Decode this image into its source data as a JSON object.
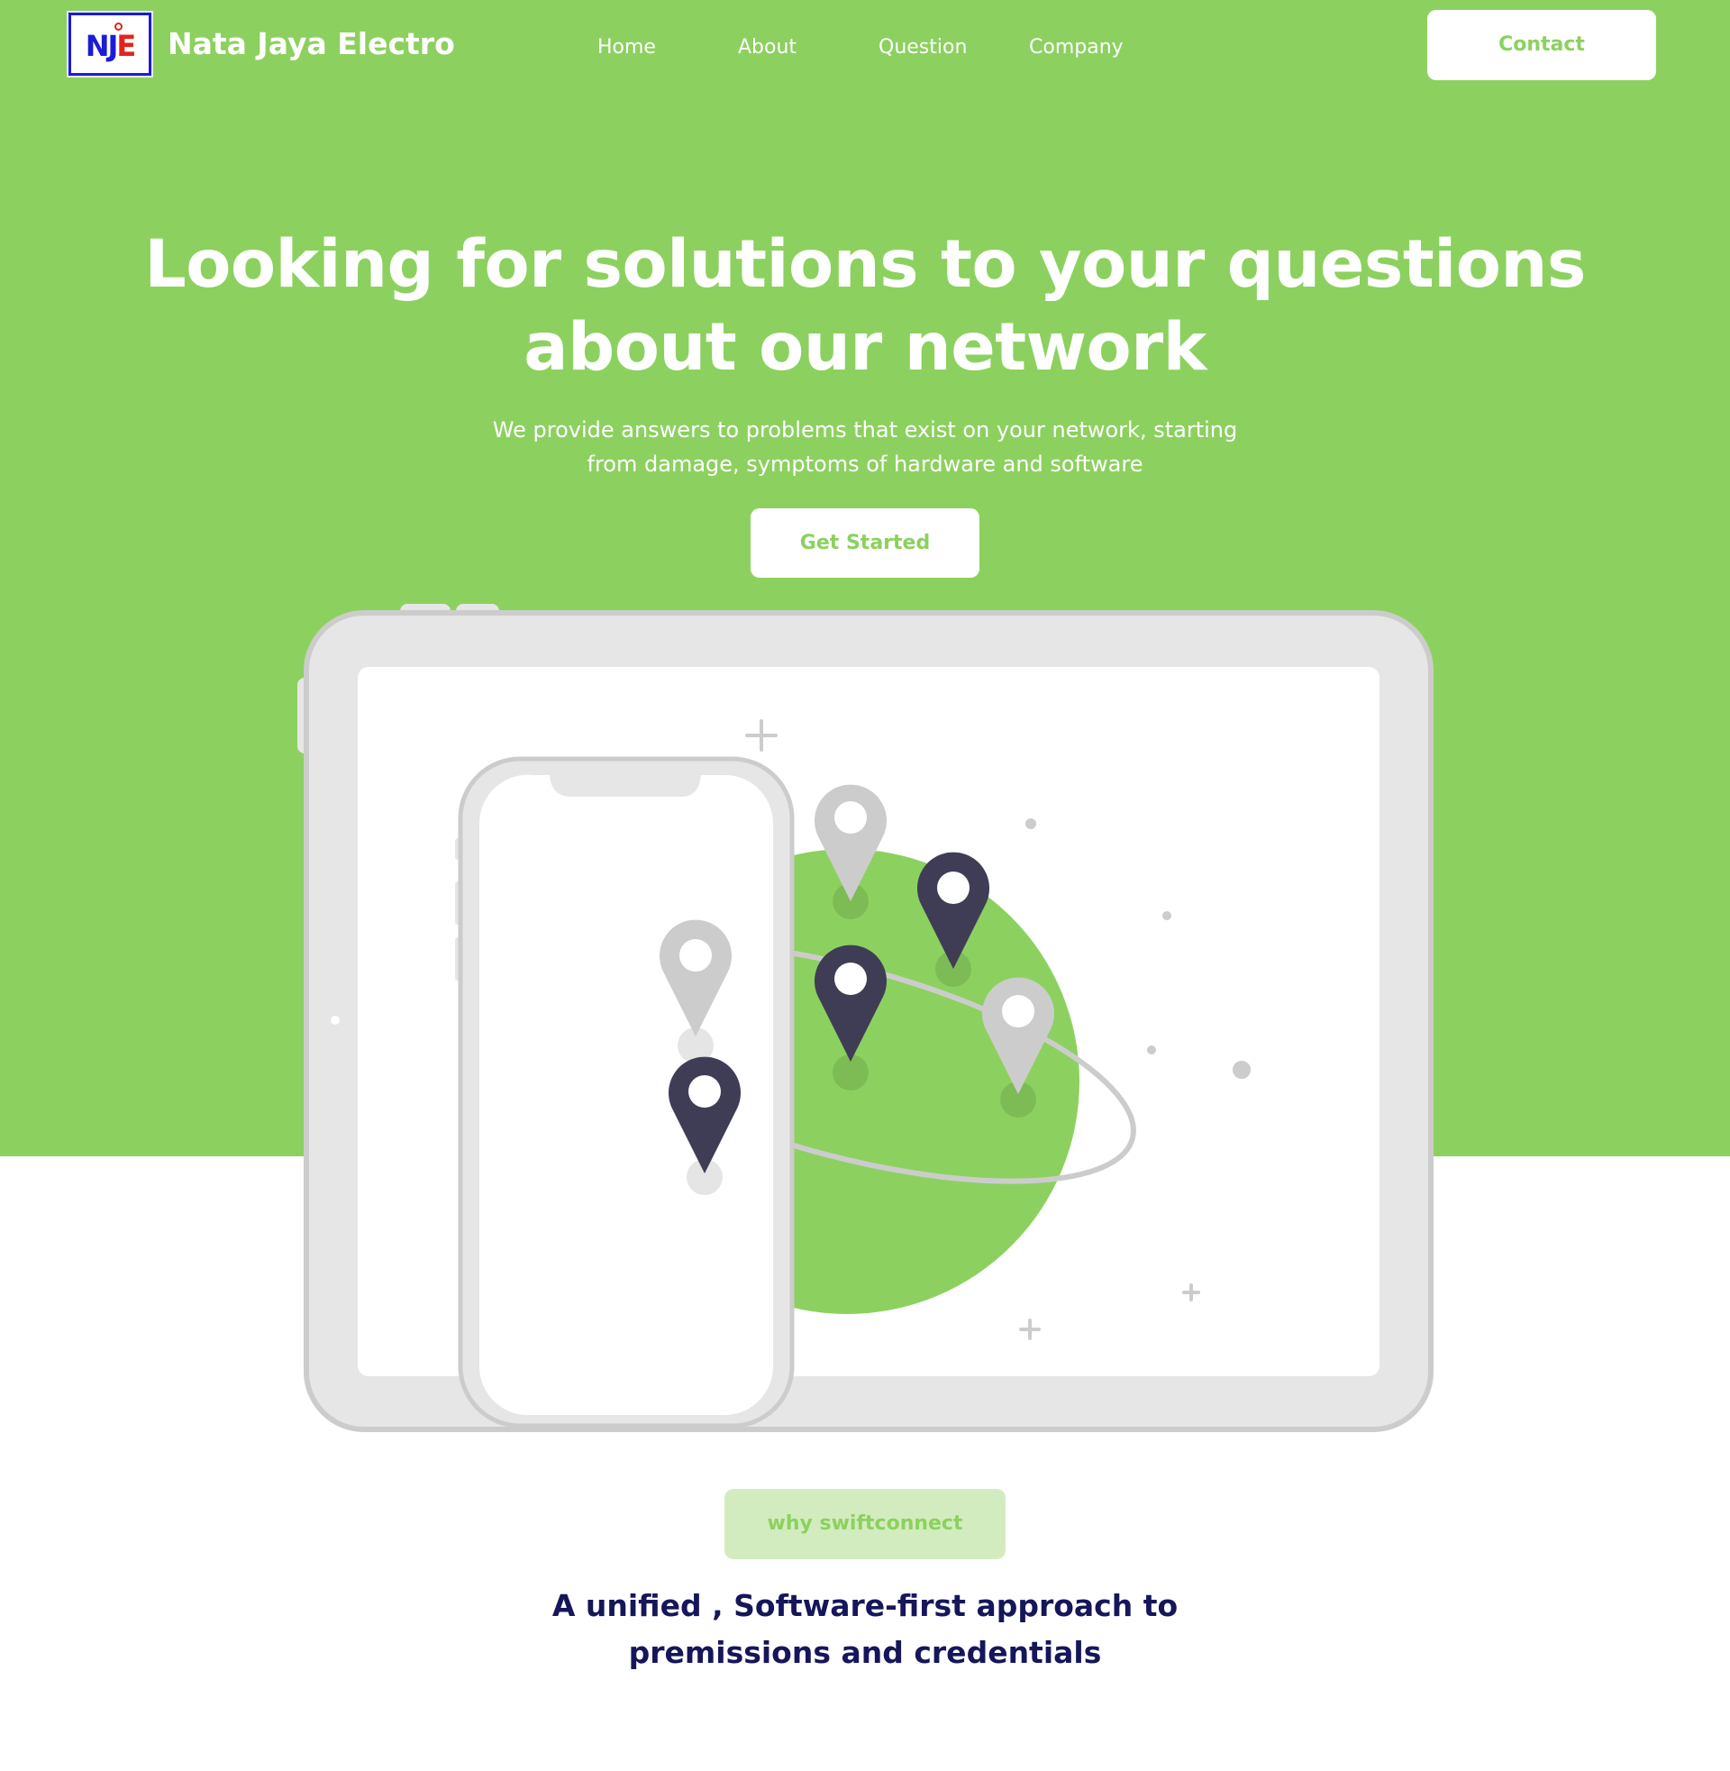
{
  "nav": {
    "logo_letters_1": "NJ",
    "logo_letters_2": "E",
    "brand": "Nata Jaya Electro",
    "links": [
      "Home",
      "About",
      "Question",
      "Company"
    ],
    "contact_label": "Contact"
  },
  "hero": {
    "title_line1": "Looking for solutions to your questions",
    "title_line2": "about our network",
    "subtitle_line1": "We provide answers to problems that exist on your network, starting",
    "subtitle_line2": "from damage, symptoms of hardware and software",
    "cta_label": "Get Started"
  },
  "section": {
    "pill_label": "why swiftconnect",
    "title_line1": "A unified , Software-first approach to",
    "title_line2": "premissions and credentials"
  },
  "colors": {
    "brand_green": "#8cd15f",
    "pill_bg": "#d3ecbf",
    "heading_navy": "#16165a",
    "pin_dark": "#3f3d56",
    "pin_light": "#cccccc"
  }
}
